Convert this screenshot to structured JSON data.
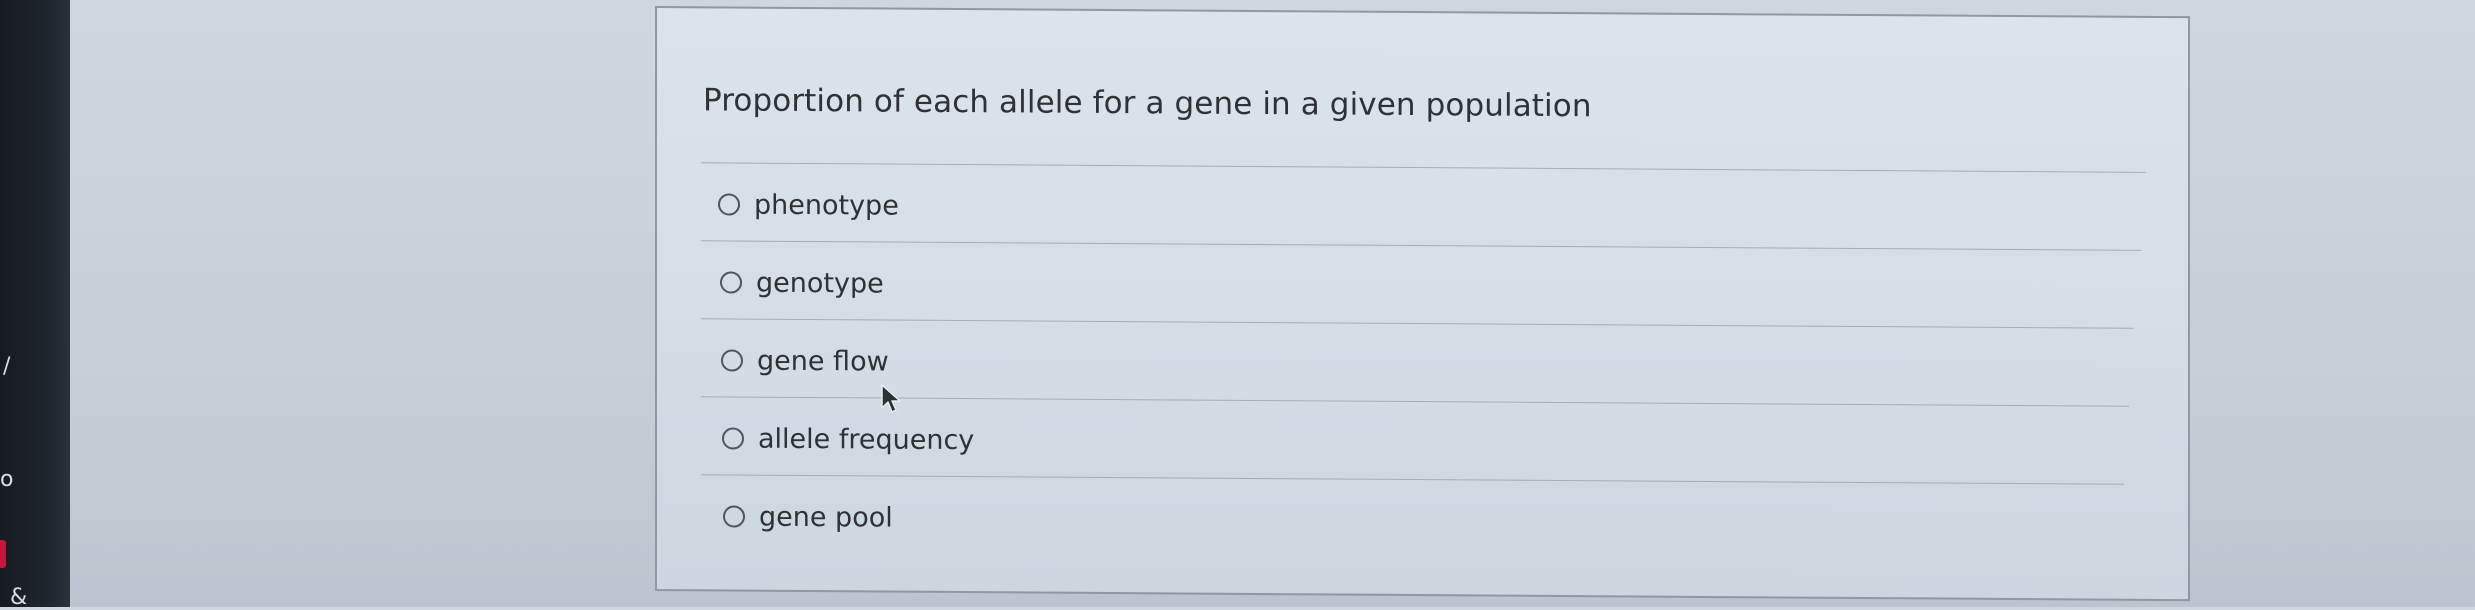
{
  "question": {
    "prompt": "Proportion of each allele for a gene in a given population",
    "options": [
      {
        "label": "phenotype",
        "selected": false
      },
      {
        "label": "genotype",
        "selected": false
      },
      {
        "label": "gene flow",
        "selected": false
      },
      {
        "label": "allele frequency",
        "selected": false
      },
      {
        "label": "gene pool",
        "selected": false
      }
    ]
  },
  "left_edge": {
    "marks": [
      "/",
      "o",
      "&"
    ],
    "accent_color": "#c3183c"
  },
  "colors": {
    "background": "#c7d0d8",
    "card_background": "#d8e1ea",
    "text": "#2f3136",
    "divider": "#9fa8b1"
  },
  "icons": {
    "radio": "radio-button-icon",
    "cursor": "mouse-pointer-icon"
  }
}
